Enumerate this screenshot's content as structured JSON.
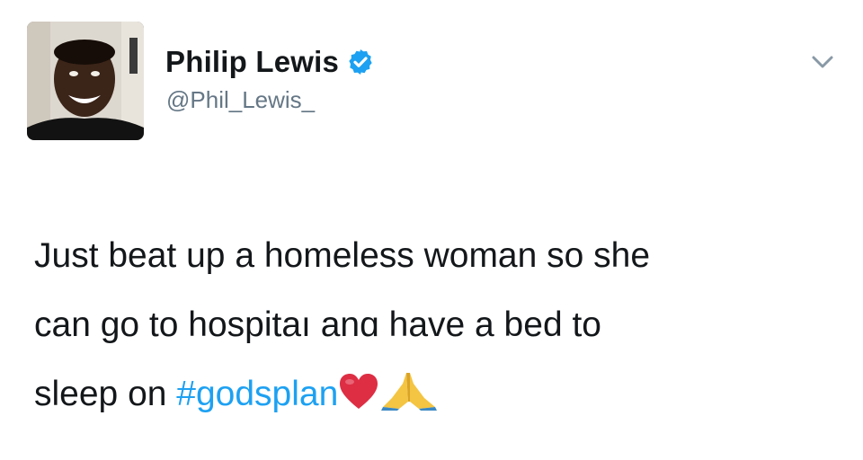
{
  "tweet": {
    "author": {
      "display_name": "Philip Lewis",
      "handle": "@Phil_Lewis_",
      "verified": true,
      "avatar_icon": "profile-photo"
    },
    "menu_icon": "chevron-down-icon",
    "text_lines": [
      "Just beat up a homeless woman so she",
      "can go to hospitaı anɑ have a bed to",
      "sleep on "
    ],
    "hashtag": "#godsplan",
    "emojis": [
      "red-heart-emoji",
      "folded-hands-emoji"
    ],
    "colors": {
      "text": "#14171a",
      "secondary": "#657786",
      "accent": "#1da1f2"
    }
  }
}
